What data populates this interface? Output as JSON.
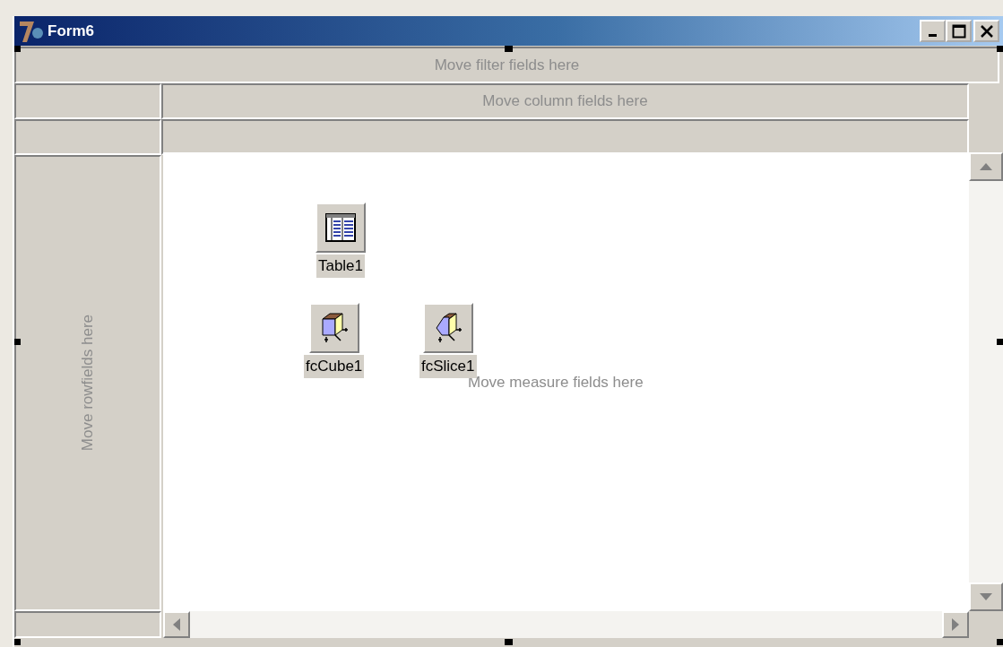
{
  "window": {
    "title": "Form6"
  },
  "filter_area": {
    "hint": "Move filter fields here"
  },
  "column_area": {
    "hint": "Move column fields here"
  },
  "row_area": {
    "hint": "Move rowfields here"
  },
  "data_area": {
    "hint": "Move measure fields here"
  },
  "components": [
    {
      "kind": "table",
      "label": "Table1"
    },
    {
      "kind": "cube",
      "label": "fcCube1"
    },
    {
      "kind": "slice",
      "label": "fcSlice1"
    }
  ]
}
